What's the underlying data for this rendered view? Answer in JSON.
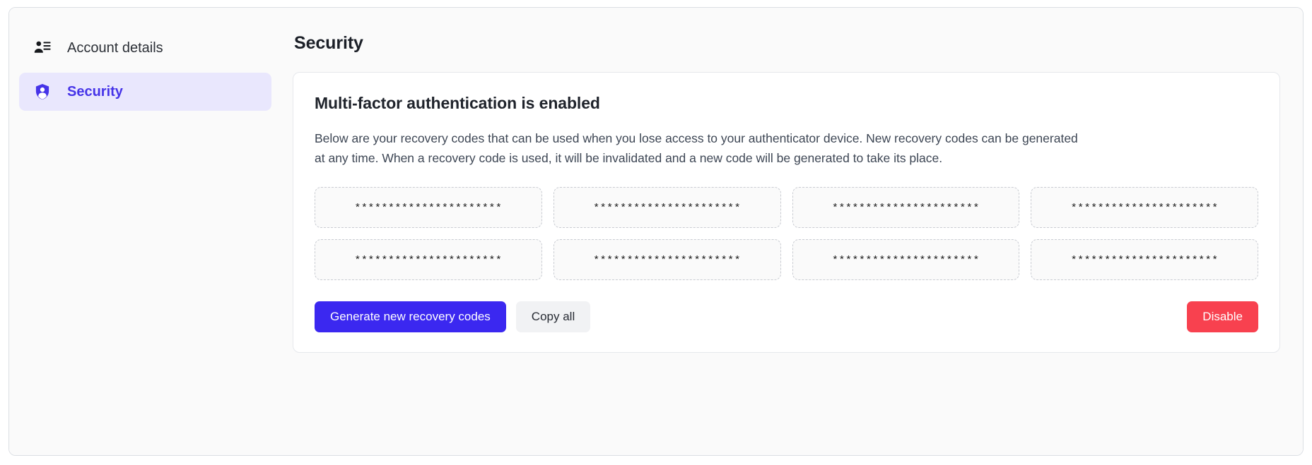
{
  "sidebar": {
    "items": [
      {
        "label": "Account details",
        "icon": "account-details-icon",
        "active": false
      },
      {
        "label": "Security",
        "icon": "shield-user-icon",
        "active": true
      }
    ]
  },
  "main": {
    "page_title": "Security",
    "card": {
      "title": "Multi-factor authentication is enabled",
      "description": "Below are your recovery codes that can be used when you lose access to your authenticator device. New recovery codes can be generated at any time. When a recovery code is used, it will be invalidated and a new code will be generated to take its place.",
      "recovery_codes": [
        "**********************",
        "**********************",
        "**********************",
        "**********************",
        "**********************",
        "**********************",
        "**********************",
        "**********************"
      ],
      "actions": {
        "generate_label": "Generate new recovery codes",
        "copy_all_label": "Copy all",
        "disable_label": "Disable"
      }
    }
  },
  "colors": {
    "accent": "#3b28f0",
    "accent_soft_bg": "#e9e7fd",
    "danger": "#f8414f",
    "secondary_btn_bg": "#f1f2f4",
    "page_bg": "#fafafa",
    "card_bg": "#ffffff"
  }
}
